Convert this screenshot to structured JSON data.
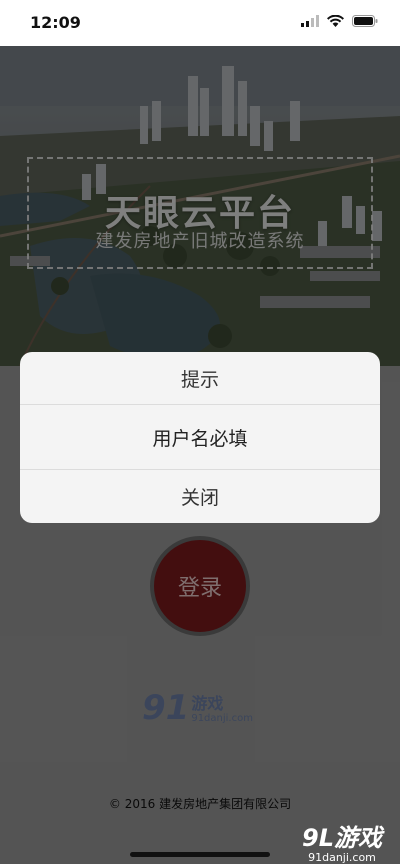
{
  "status": {
    "time": "12:09"
  },
  "hero": {
    "title": "天眼云平台",
    "subtitle": "建发房地产旧城改造系统"
  },
  "login": {
    "label": "登录"
  },
  "dialog": {
    "title": "提示",
    "message": "用户名必填",
    "close_label": "关闭"
  },
  "watermark": {
    "logo_number": "91",
    "logo_cn": "游戏",
    "logo_domain": "91danji.com"
  },
  "footer": {
    "copyright": "© 2016  建发房地产集团有限公司"
  },
  "corner_watermark": {
    "main": "9L游戏",
    "domain": "91danji.com"
  }
}
